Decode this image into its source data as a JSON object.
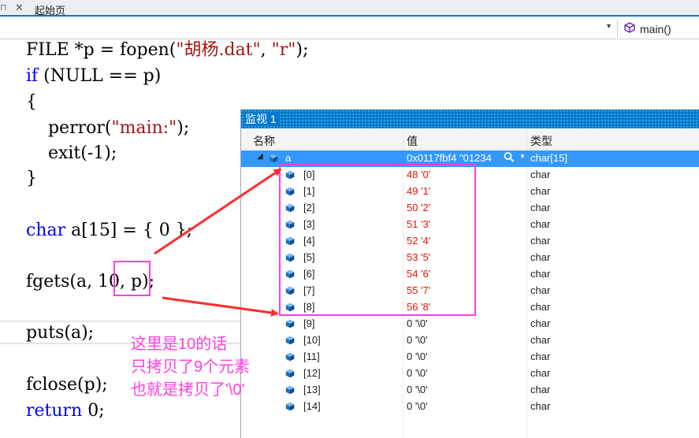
{
  "tabbar": {
    "tab_title": "起始页"
  },
  "navbar": {
    "function_label": "main()"
  },
  "code": {
    "line1": {
      "a": "FILE *p = fopen(",
      "s1": "\"胡杨.dat\"",
      "b": ", ",
      "s2": "\"r\"",
      "c": ");"
    },
    "line2": {
      "kw": "if",
      "rest": " (NULL == p)"
    },
    "line3": "{",
    "line4": {
      "a": "    perror(",
      "s": "\"main:\"",
      "b": ");"
    },
    "line5": "    exit(-1);",
    "line6": "}",
    "line7": {
      "kw": "char",
      "rest": " a[15] = { 0 };"
    },
    "line8": "fgets(a, 10, p);",
    "line9": "puts(a);",
    "line10": "fclose(p);",
    "line11": {
      "kw": "return",
      "rest": " 0;"
    }
  },
  "watch": {
    "title": "监视 1",
    "columns": {
      "name": "名称",
      "value": "值",
      "type": "类型"
    },
    "parent": {
      "name": "a",
      "value": "0x0117fbf4 \"01234",
      "type": "char[15]"
    },
    "items": [
      {
        "name": "[0]",
        "value": "48 '0'",
        "type": "char"
      },
      {
        "name": "[1]",
        "value": "49 '1'",
        "type": "char"
      },
      {
        "name": "[2]",
        "value": "50 '2'",
        "type": "char"
      },
      {
        "name": "[3]",
        "value": "51 '3'",
        "type": "char"
      },
      {
        "name": "[4]",
        "value": "52 '4'",
        "type": "char"
      },
      {
        "name": "[5]",
        "value": "53 '5'",
        "type": "char"
      },
      {
        "name": "[6]",
        "value": "54 '6'",
        "type": "char"
      },
      {
        "name": "[7]",
        "value": "55 '7'",
        "type": "char"
      },
      {
        "name": "[8]",
        "value": "56 '8'",
        "type": "char"
      },
      {
        "name": "[9]",
        "value": "0 '\\0'",
        "type": "char"
      },
      {
        "name": "[10]",
        "value": "0 '\\0'",
        "type": "char"
      },
      {
        "name": "[11]",
        "value": "0 '\\0'",
        "type": "char"
      },
      {
        "name": "[12]",
        "value": "0 '\\0'",
        "type": "char"
      },
      {
        "name": "[13]",
        "value": "0 '\\0'",
        "type": "char"
      },
      {
        "name": "[14]",
        "value": "0 '\\0'",
        "type": "char"
      }
    ]
  },
  "annotation": {
    "line1": "这里是10的话",
    "line2": "只拷贝了9个元素",
    "line3": "也就是拷贝了'\\0'"
  },
  "colors": {
    "accent": "#007acc",
    "selection": "#3399ff",
    "changed_value": "#e51400",
    "annotation": "#ff3fe0",
    "arrow": "#ff2d2d"
  }
}
